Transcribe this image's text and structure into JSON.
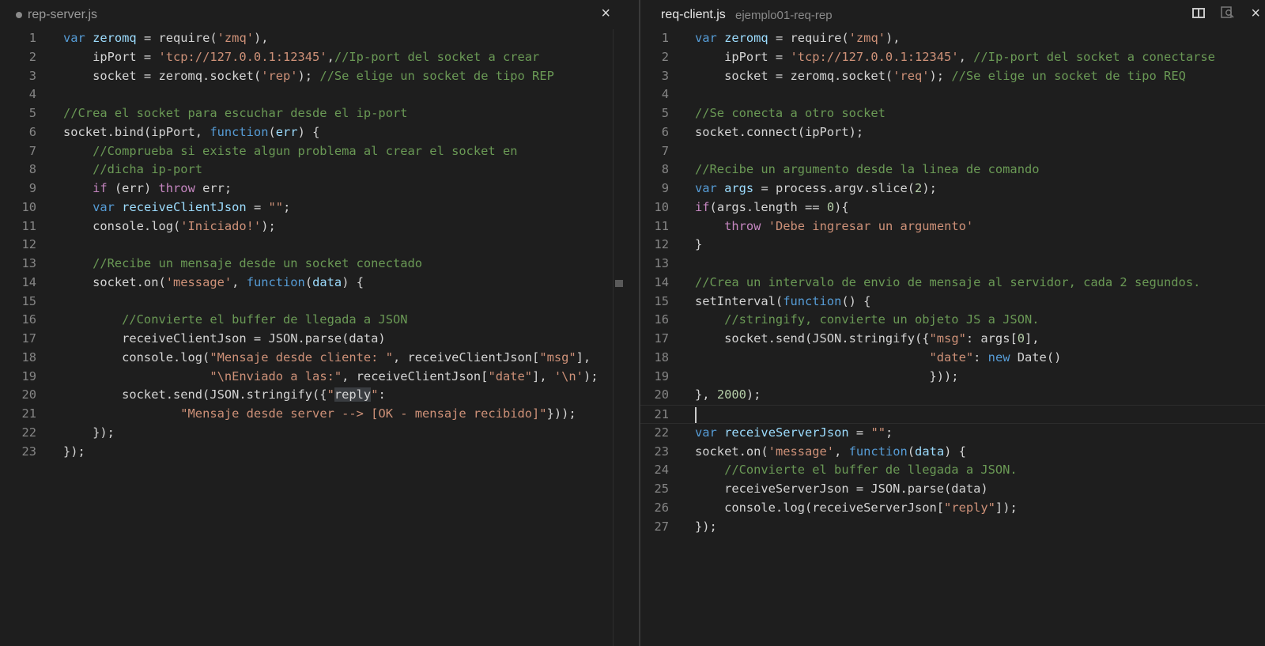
{
  "left_editor": {
    "tab": {
      "title": "rep-server.js",
      "modified": true,
      "close_glyph": "×"
    },
    "lines": [
      {
        "n": "1",
        "tokens": [
          [
            "k",
            "var"
          ],
          [
            "t",
            " "
          ],
          [
            "v",
            "zeromq"
          ],
          [
            "t",
            " = require("
          ],
          [
            "s",
            "'zmq'"
          ],
          [
            "t",
            "),"
          ]
        ]
      },
      {
        "n": "2",
        "tokens": [
          [
            "t",
            "    ipPort = "
          ],
          [
            "s",
            "'tcp://127.0.0.1:12345'"
          ],
          [
            "t",
            ","
          ],
          [
            "c",
            "//Ip-port del socket a crear"
          ]
        ]
      },
      {
        "n": "3",
        "tokens": [
          [
            "t",
            "    socket = zeromq.socket("
          ],
          [
            "s",
            "'rep'"
          ],
          [
            "t",
            "); "
          ],
          [
            "c",
            "//Se elige un socket de tipo REP"
          ]
        ]
      },
      {
        "n": "4",
        "tokens": []
      },
      {
        "n": "5",
        "tokens": [
          [
            "c",
            "//Crea el socket para escuchar desde el ip-port"
          ]
        ]
      },
      {
        "n": "6",
        "tokens": [
          [
            "t",
            "socket.bind(ipPort, "
          ],
          [
            "k",
            "function"
          ],
          [
            "t",
            "("
          ],
          [
            "v",
            "err"
          ],
          [
            "t",
            ") {"
          ]
        ]
      },
      {
        "n": "7",
        "tokens": [
          [
            "c",
            "    //Comprueba si existe algun problema al crear el socket en"
          ]
        ]
      },
      {
        "n": "8",
        "tokens": [
          [
            "c",
            "    //dicha ip-port"
          ]
        ]
      },
      {
        "n": "9",
        "tokens": [
          [
            "t",
            "    "
          ],
          [
            "kc",
            "if"
          ],
          [
            "t",
            " (err) "
          ],
          [
            "kc",
            "throw"
          ],
          [
            "t",
            " err;"
          ]
        ]
      },
      {
        "n": "10",
        "tokens": [
          [
            "t",
            "    "
          ],
          [
            "k",
            "var"
          ],
          [
            "t",
            " "
          ],
          [
            "v",
            "receiveClientJson"
          ],
          [
            "t",
            " = "
          ],
          [
            "s",
            "\"\""
          ],
          [
            "t",
            ";"
          ]
        ]
      },
      {
        "n": "11",
        "tokens": [
          [
            "t",
            "    console.log("
          ],
          [
            "s",
            "'Iniciado!'"
          ],
          [
            "t",
            ");"
          ]
        ]
      },
      {
        "n": "12",
        "tokens": []
      },
      {
        "n": "13",
        "tokens": [
          [
            "c",
            "    //Recibe un mensaje desde un socket conectado"
          ]
        ]
      },
      {
        "n": "14",
        "tokens": [
          [
            "t",
            "    socket.on("
          ],
          [
            "s",
            "'message'"
          ],
          [
            "t",
            ", "
          ],
          [
            "k",
            "function"
          ],
          [
            "t",
            "("
          ],
          [
            "v",
            "data"
          ],
          [
            "t",
            ") {"
          ]
        ]
      },
      {
        "n": "15",
        "tokens": []
      },
      {
        "n": "16",
        "tokens": [
          [
            "c",
            "        //Convierte el buffer de llegada a JSON"
          ]
        ]
      },
      {
        "n": "17",
        "tokens": [
          [
            "t",
            "        receiveClientJson = JSON.parse(data)"
          ]
        ]
      },
      {
        "n": "18",
        "tokens": [
          [
            "t",
            "        console.log("
          ],
          [
            "s",
            "\"Mensaje desde cliente: \""
          ],
          [
            "t",
            ", receiveClientJson["
          ],
          [
            "s",
            "\"msg\""
          ],
          [
            "t",
            "],"
          ]
        ]
      },
      {
        "n": "19",
        "tokens": [
          [
            "t",
            "                    "
          ],
          [
            "s",
            "\"\\nEnviado a las:\""
          ],
          [
            "t",
            ", receiveClientJson["
          ],
          [
            "s",
            "\"date\""
          ],
          [
            "t",
            "], "
          ],
          [
            "s",
            "'\\n'"
          ],
          [
            "t",
            ");"
          ]
        ]
      },
      {
        "n": "20",
        "tokens": [
          [
            "t",
            "        socket.send(JSON.stringify({"
          ],
          [
            "s",
            "\""
          ],
          [
            "hl",
            "reply"
          ],
          [
            "s",
            "\""
          ],
          [
            "t",
            ":"
          ]
        ]
      },
      {
        "n": "21",
        "tokens": [
          [
            "t",
            "                "
          ],
          [
            "s",
            "\"Mensaje desde server --> [OK - mensaje recibido]\""
          ],
          [
            "t",
            "}));"
          ]
        ]
      },
      {
        "n": "22",
        "tokens": [
          [
            "t",
            "    });"
          ]
        ]
      },
      {
        "n": "23",
        "tokens": [
          [
            "t",
            "});"
          ]
        ]
      }
    ]
  },
  "right_editor": {
    "tab": {
      "title": "req-client.js",
      "path": "ejemplo01-req-rep",
      "close_glyph": "×"
    },
    "cursor_line": "21",
    "lines": [
      {
        "n": "1",
        "tokens": [
          [
            "k",
            "var"
          ],
          [
            "t",
            " "
          ],
          [
            "v",
            "zeromq"
          ],
          [
            "t",
            " = require("
          ],
          [
            "s",
            "'zmq'"
          ],
          [
            "t",
            "),"
          ]
        ]
      },
      {
        "n": "2",
        "tokens": [
          [
            "t",
            "    ipPort = "
          ],
          [
            "s",
            "'tcp://127.0.0.1:12345'"
          ],
          [
            "t",
            ", "
          ],
          [
            "c",
            "//Ip-port del socket a conectarse"
          ]
        ]
      },
      {
        "n": "3",
        "tokens": [
          [
            "t",
            "    socket = zeromq.socket("
          ],
          [
            "s",
            "'req'"
          ],
          [
            "t",
            "); "
          ],
          [
            "c",
            "//Se elige un socket de tipo REQ"
          ]
        ]
      },
      {
        "n": "4",
        "tokens": []
      },
      {
        "n": "5",
        "tokens": [
          [
            "c",
            "//Se conecta a otro socket"
          ]
        ]
      },
      {
        "n": "6",
        "tokens": [
          [
            "t",
            "socket.connect(ipPort);"
          ]
        ]
      },
      {
        "n": "7",
        "tokens": []
      },
      {
        "n": "8",
        "tokens": [
          [
            "c",
            "//Recibe un argumento desde la linea de comando"
          ]
        ]
      },
      {
        "n": "9",
        "tokens": [
          [
            "k",
            "var"
          ],
          [
            "t",
            " "
          ],
          [
            "v",
            "args"
          ],
          [
            "t",
            " = process.argv.slice("
          ],
          [
            "n",
            "2"
          ],
          [
            "t",
            ");"
          ]
        ]
      },
      {
        "n": "10",
        "tokens": [
          [
            "kc",
            "if"
          ],
          [
            "t",
            "(args.length == "
          ],
          [
            "n",
            "0"
          ],
          [
            "t",
            "){"
          ]
        ]
      },
      {
        "n": "11",
        "tokens": [
          [
            "t",
            "    "
          ],
          [
            "kc",
            "throw"
          ],
          [
            "t",
            " "
          ],
          [
            "s",
            "'Debe ingresar un argumento'"
          ]
        ]
      },
      {
        "n": "12",
        "tokens": [
          [
            "t",
            "}"
          ]
        ]
      },
      {
        "n": "13",
        "tokens": []
      },
      {
        "n": "14",
        "tokens": [
          [
            "c",
            "//Crea un intervalo de envio de mensaje al servidor, cada 2 segundos."
          ]
        ]
      },
      {
        "n": "15",
        "tokens": [
          [
            "t",
            "setInterval("
          ],
          [
            "k",
            "function"
          ],
          [
            "t",
            "() {"
          ]
        ]
      },
      {
        "n": "16",
        "tokens": [
          [
            "c",
            "    //stringify, convierte un objeto JS a JSON."
          ]
        ]
      },
      {
        "n": "17",
        "tokens": [
          [
            "t",
            "    socket.send(JSON.stringify({"
          ],
          [
            "s",
            "\"msg\""
          ],
          [
            "t",
            ": args["
          ],
          [
            "n",
            "0"
          ],
          [
            "t",
            "],"
          ]
        ]
      },
      {
        "n": "18",
        "tokens": [
          [
            "t",
            "                                "
          ],
          [
            "s",
            "\"date\""
          ],
          [
            "t",
            ": "
          ],
          [
            "k",
            "new"
          ],
          [
            "t",
            " Date()"
          ]
        ]
      },
      {
        "n": "19",
        "tokens": [
          [
            "t",
            "                                }));"
          ]
        ]
      },
      {
        "n": "20",
        "tokens": [
          [
            "t",
            "}, "
          ],
          [
            "n",
            "2000"
          ],
          [
            "t",
            ");"
          ]
        ]
      },
      {
        "n": "21",
        "tokens": []
      },
      {
        "n": "22",
        "tokens": [
          [
            "k",
            "var"
          ],
          [
            "t",
            " "
          ],
          [
            "v",
            "receiveServerJson"
          ],
          [
            "t",
            " = "
          ],
          [
            "s",
            "\"\""
          ],
          [
            "t",
            ";"
          ]
        ]
      },
      {
        "n": "23",
        "tokens": [
          [
            "t",
            "socket.on("
          ],
          [
            "s",
            "'message'"
          ],
          [
            "t",
            ", "
          ],
          [
            "k",
            "function"
          ],
          [
            "t",
            "("
          ],
          [
            "v",
            "data"
          ],
          [
            "t",
            ") {"
          ]
        ]
      },
      {
        "n": "24",
        "tokens": [
          [
            "c",
            "    //Convierte el buffer de llegada a JSON."
          ]
        ]
      },
      {
        "n": "25",
        "tokens": [
          [
            "t",
            "    receiveServerJson = JSON.parse(data)"
          ]
        ]
      },
      {
        "n": "26",
        "tokens": [
          [
            "t",
            "    console.log(receiveServerJson["
          ],
          [
            "s",
            "\"reply\""
          ],
          [
            "t",
            "]);"
          ]
        ]
      },
      {
        "n": "27",
        "tokens": [
          [
            "t",
            "});"
          ]
        ]
      }
    ]
  },
  "icons": {
    "split": "split-editor-icon",
    "preview": "open-preview-icon",
    "modified": "modified-dot-icon"
  }
}
